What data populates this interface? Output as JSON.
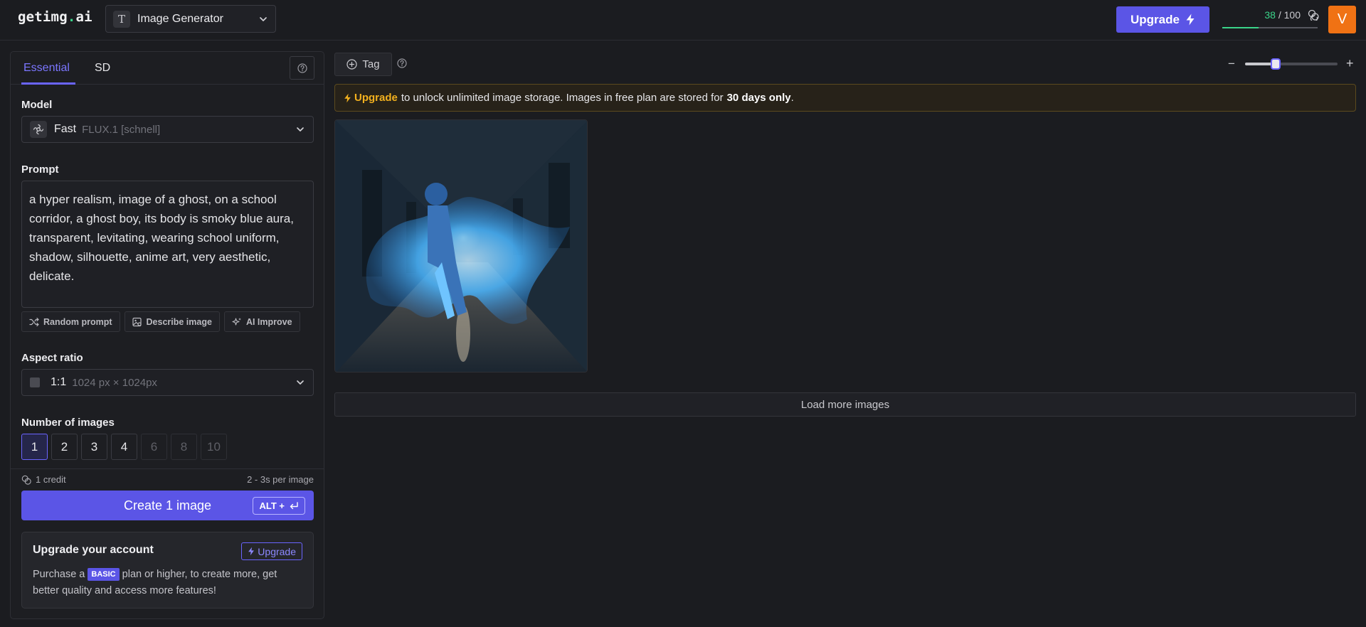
{
  "header": {
    "logo_prefix": "getimg",
    "logo_dot": ".",
    "logo_suffix": "ai",
    "tool_icon_letter": "T",
    "tool_label": "Image Generator",
    "upgrade_label": "Upgrade",
    "credits_used": "38",
    "credits_total": "/ 100",
    "credits_fraction": 0.38,
    "avatar_letter": "V"
  },
  "panel": {
    "tabs": [
      {
        "label": "Essential",
        "active": true
      },
      {
        "label": "SD",
        "active": false
      }
    ],
    "model": {
      "label": "Model",
      "name": "Fast",
      "variant": "FLUX.1 [schnell]"
    },
    "prompt": {
      "label": "Prompt",
      "value": "a hyper realism, image of a ghost, on a school corridor, a ghost boy, its body is smoky blue aura, transparent, levitating, wearing school uniform, shadow, silhouette, anime art, very aesthetic, delicate."
    },
    "prompt_actions": [
      "Random prompt",
      "Describe image",
      "AI Improve"
    ],
    "aspect": {
      "label": "Aspect ratio",
      "ratio": "1:1",
      "size": "1024 px × 1024px"
    },
    "number_of_images": {
      "label": "Number of images",
      "options": [
        "1",
        "2",
        "3",
        "4",
        "6",
        "8",
        "10"
      ],
      "selected": "1",
      "disabled": [
        "6",
        "8",
        "10"
      ]
    },
    "cost": "1 credit",
    "speed": "2 - 3s per image",
    "create_label": "Create 1 image",
    "shortcut": "ALT +",
    "upgrade_card": {
      "title": "Upgrade your account",
      "button": "Upgrade",
      "text_before": "Purchase a",
      "badge": "BASIC",
      "text_after": "plan or higher, to create more, get better quality and access more features!"
    }
  },
  "main": {
    "tag_label": "Tag",
    "zoom_level": 0.33,
    "zoom_minus": "−",
    "zoom_plus": "+",
    "banner": {
      "link": "Upgrade",
      "text": "to unlock unlimited image storage. Images in free plan are stored for",
      "bold": "30 days only",
      "end": "."
    },
    "load_more": "Load more images"
  },
  "colors": {
    "accent": "#5b55e6",
    "credits_green": "#3ad48a",
    "avatar_orange": "#f07214",
    "banner_highlight": "#f2b01e"
  }
}
